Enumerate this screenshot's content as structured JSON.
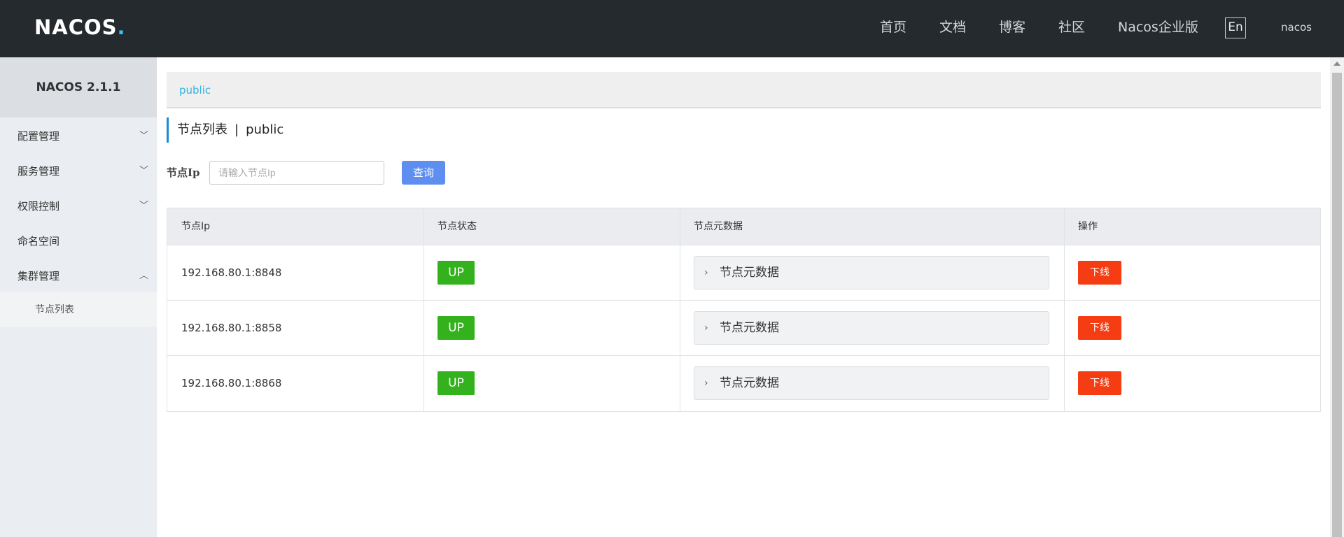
{
  "header": {
    "logo_text": "NACOS",
    "nav": [
      {
        "label": "首页"
      },
      {
        "label": "文档"
      },
      {
        "label": "博客"
      },
      {
        "label": "社区"
      },
      {
        "label": "Nacos企业版"
      }
    ],
    "lang_label": "En",
    "username": "nacos",
    "logo_accent_color": "#2fc7f5"
  },
  "sidebar": {
    "title": "NACOS 2.1.1",
    "items": [
      {
        "label": "配置管理",
        "expanded": false
      },
      {
        "label": "服务管理",
        "expanded": false
      },
      {
        "label": "权限控制",
        "expanded": false
      },
      {
        "label": "命名空间"
      },
      {
        "label": "集群管理",
        "expanded": true
      }
    ],
    "sub_items": [
      {
        "label": "节点列表"
      }
    ]
  },
  "main": {
    "namespace_link": "public",
    "page_title": "节点列表",
    "page_title_separator": "|",
    "page_title_namespace": "public",
    "filter": {
      "label": "节点Ip",
      "placeholder": "请输入节点Ip",
      "value": "",
      "query_label": "查询"
    },
    "table": {
      "columns": [
        "节点Ip",
        "节点状态",
        "节点元数据",
        "操作"
      ],
      "rows": [
        {
          "ip": "192.168.80.1:8848",
          "status": "UP",
          "metadata_label": "节点元数据",
          "action": "下线"
        },
        {
          "ip": "192.168.80.1:8858",
          "status": "UP",
          "metadata_label": "节点元数据",
          "action": "下线"
        },
        {
          "ip": "192.168.80.1:8868",
          "status": "UP",
          "metadata_label": "节点元数据",
          "action": "下线"
        }
      ]
    }
  },
  "colors": {
    "header_bg": "#252a2f",
    "status_up": "#34b21d",
    "offline_button": "#f53c12",
    "query_button": "#5d8ef0",
    "link": "#2fb4e5"
  }
}
